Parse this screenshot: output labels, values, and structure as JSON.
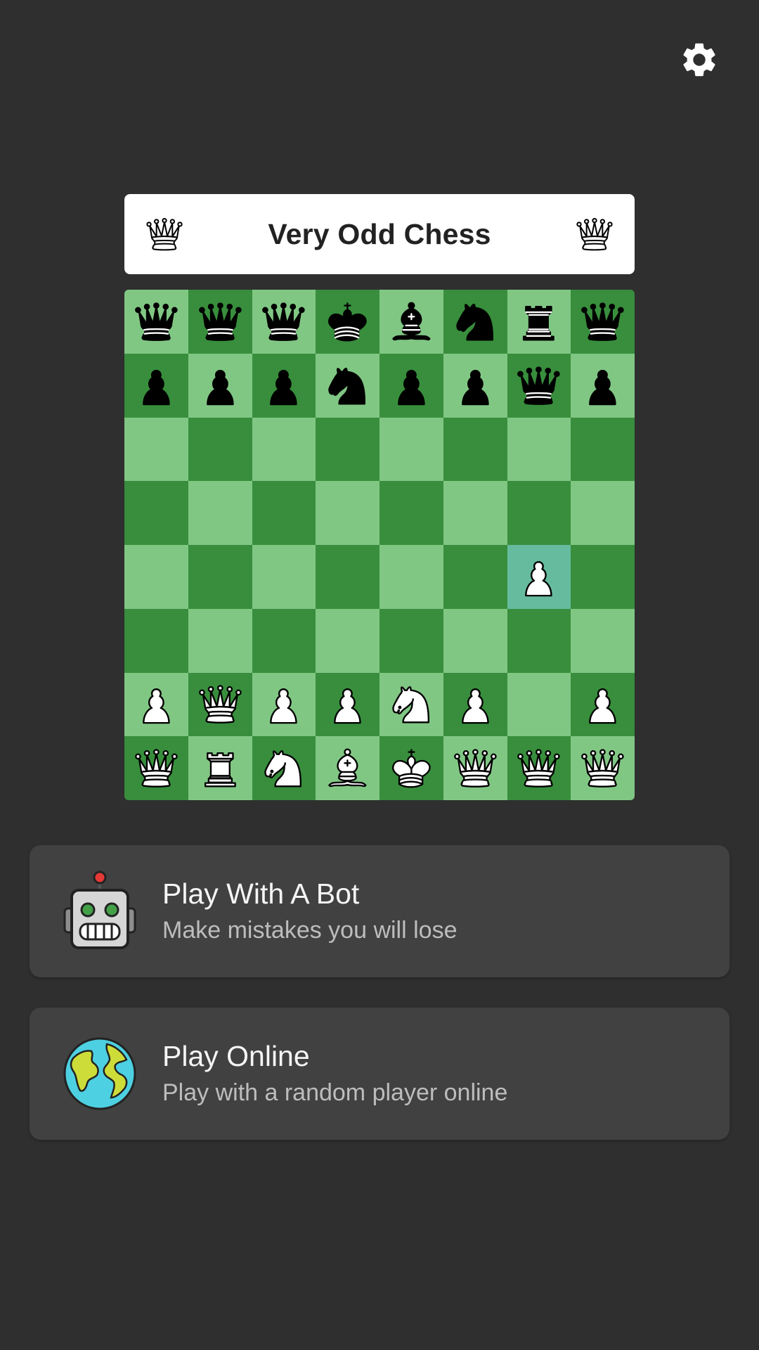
{
  "app": {
    "title": "Very Odd Chess"
  },
  "board": {
    "rows": [
      [
        "bq",
        "bq",
        "bq",
        "bk",
        "bb",
        "bn",
        "br",
        "bq"
      ],
      [
        "bp",
        "bp",
        "bp",
        "bn",
        "bp",
        "bp",
        "bq",
        "bp"
      ],
      [
        "",
        "",
        "",
        "",
        "",
        "",
        "",
        ""
      ],
      [
        "",
        "",
        "",
        "",
        "",
        "",
        "",
        ""
      ],
      [
        "",
        "",
        "",
        "",
        "",
        "",
        "wp",
        ""
      ],
      [
        "",
        "",
        "",
        "",
        "",
        "",
        "",
        ""
      ],
      [
        "wp",
        "wq",
        "wp",
        "wp",
        "wn",
        "wp",
        "",
        "wp"
      ],
      [
        "wq",
        "wr",
        "wn",
        "wb",
        "wk",
        "wq",
        "wq",
        "wq"
      ]
    ],
    "highlight": {
      "row": 4,
      "col": 6
    },
    "colors": {
      "light": "#81c784",
      "dark": "#388e3c",
      "highlight": "#66bb9e"
    }
  },
  "menu": {
    "bot": {
      "title": "Play With A Bot",
      "subtitle": "Make mistakes you will lose",
      "icon": "robot-icon"
    },
    "online": {
      "title": "Play Online",
      "subtitle": "Play with a random player online",
      "icon": "globe-icon"
    }
  },
  "icons": {
    "settings": "gear-icon",
    "title_left": "queen-icon",
    "title_right": "queen-icon"
  },
  "colors": {
    "background": "#2f2f2f",
    "card": "#414141"
  }
}
